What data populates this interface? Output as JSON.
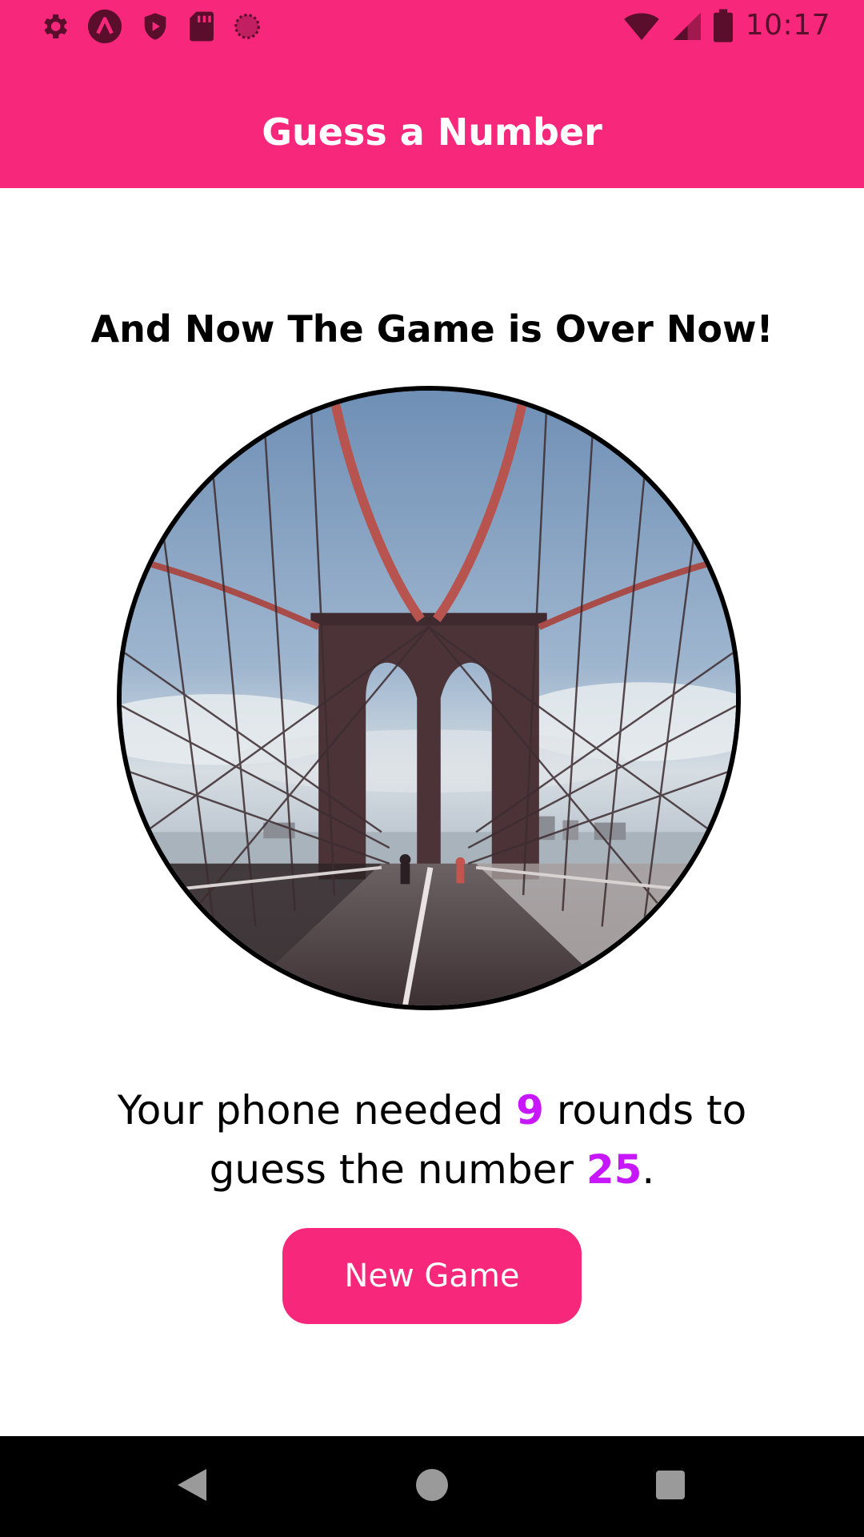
{
  "status_bar": {
    "time": "10:17",
    "left_icons": [
      "settings-icon",
      "app-a-icon",
      "play-protect-icon",
      "sd-card-icon",
      "circle-dotted-icon"
    ],
    "right_icons": [
      "wifi-icon",
      "cell-signal-icon",
      "battery-icon"
    ]
  },
  "header": {
    "title": "Guess a Number"
  },
  "main": {
    "title": "And Now The Game is Over Now!",
    "summary": {
      "part1": "Your phone needed ",
      "rounds": "9",
      "part2": " rounds to guess the number ",
      "number": "25",
      "part3": "."
    },
    "button_label": "New Game"
  },
  "nav_bar": {
    "buttons": [
      "back-icon",
      "home-icon",
      "recents-icon"
    ]
  },
  "colors": {
    "primary": "#f7287b",
    "accent": "#c717fc",
    "status_icon": "#5a0e2c"
  }
}
